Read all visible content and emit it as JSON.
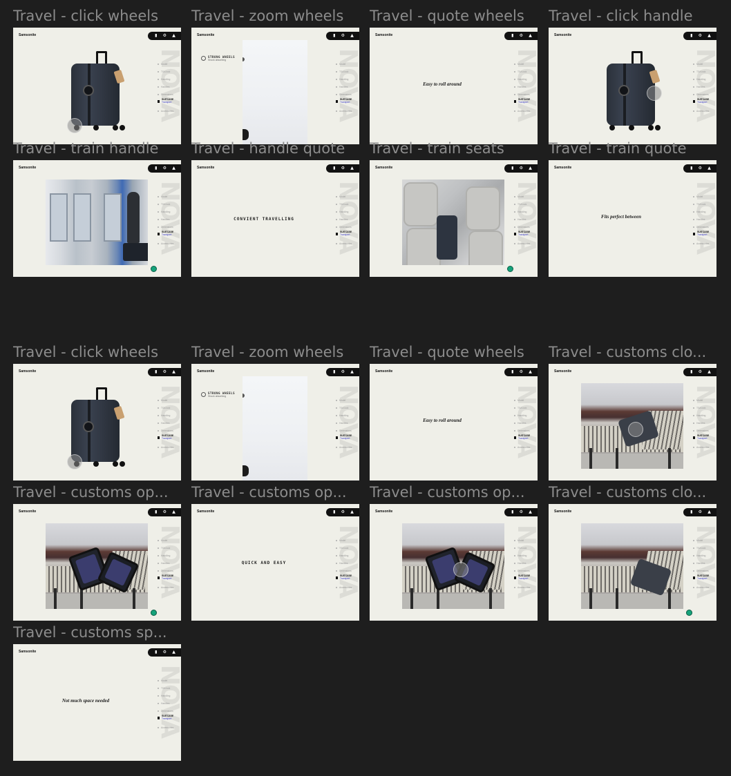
{
  "frames": [
    {
      "title": "Travel - click wheels",
      "kind": "suitcase-wheels"
    },
    {
      "title": "Travel - zoom wheels",
      "kind": "zoom"
    },
    {
      "title": "Travel - quote wheels",
      "kind": "quote",
      "quote": "Easy to roll around"
    },
    {
      "title": "Travel - click handle",
      "kind": "suitcase-handle"
    },
    {
      "title": "Travel - train handle",
      "kind": "train"
    },
    {
      "title": "Travel - handle quote",
      "kind": "caps",
      "caps": "CONVIENT TRAVELLING"
    },
    {
      "title": "Travel - train seats",
      "kind": "seats"
    },
    {
      "title": "Travel - train quote",
      "kind": "quote",
      "quote": "Fits perfect between"
    },
    {
      "title": "Travel - click wheels",
      "kind": "suitcase-wheels"
    },
    {
      "title": "Travel - zoom wheels",
      "kind": "zoom"
    },
    {
      "title": "Travel - quote wheels",
      "kind": "quote",
      "quote": "Easy to roll around"
    },
    {
      "title": "Travel - customs clo...",
      "kind": "customs-closed"
    },
    {
      "title": "Travel - customs op...",
      "kind": "customs-open"
    },
    {
      "title": "Travel - customs op...",
      "kind": "caps",
      "caps": "QUICK AND EASY"
    },
    {
      "title": "Travel - customs op...",
      "kind": "customs-open-tap"
    },
    {
      "title": "Travel - customs clo...",
      "kind": "customs-closed-b"
    },
    {
      "title": "Travel - customs sp...",
      "kind": "quote",
      "quote": "Not much space needed"
    }
  ],
  "prototype": {
    "brand": "Samsonite",
    "topbar_icons": [
      "bookmark-icon",
      "gear-icon",
      "bag-icon"
    ],
    "topbar_glyphs": [
      "▮",
      "⚙",
      "▲"
    ],
    "nav": [
      "Model",
      "TSA lock",
      "Handling",
      "Handles",
      "Dimensions"
    ],
    "nav_active_title": "SUITCASE",
    "nav_active_sub": "Transport",
    "nav_after": "Accessories",
    "side_word": "NOVA",
    "zoom_label_title": "STRONG WHEELS",
    "zoom_label_sub": "Shock absorbing"
  },
  "colors": {
    "canvas": "#1e1e1e",
    "frame_bg": "#efefe8",
    "title": "#8c8c8c",
    "accent": "#3a3ac8",
    "badge": "#16a37b"
  }
}
